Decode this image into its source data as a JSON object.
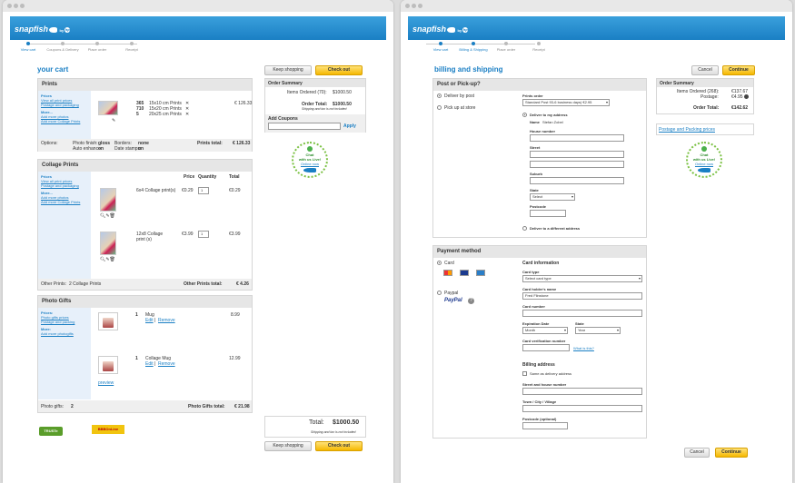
{
  "left": {
    "brand": {
      "logo": "snapfish",
      "by": "by",
      "hp": "hp"
    },
    "steps": [
      "View cart",
      "Coupons & Delivery",
      "Place order",
      "Receipt"
    ],
    "title": "your cart",
    "buttons": {
      "keep": "Keep shopping",
      "checkout": "Check out"
    },
    "summary": {
      "title": "Order Summary",
      "items_label": "Items Ordered (70):",
      "items_value": "$1000.50",
      "total_label": "Order Total:",
      "total_value": "$1000.50",
      "note": "Shipping and tax is not included",
      "coupons": "Add Coupons",
      "apply": "Apply"
    },
    "chat": {
      "line1": "Chat",
      "line2": "with us Live!",
      "link": "Online now"
    },
    "prints": {
      "header": "Prints",
      "side": {
        "prices": "Prices",
        "view": "View all print prices",
        "postage": "Postage and packaging",
        "more": "More...",
        "add_photos": "Add more photos",
        "add_collage": "Add more Collage Prints"
      },
      "rows": [
        {
          "qty": "365",
          "desc": "15x10 cm Prints"
        },
        {
          "qty": "710",
          "desc": "15x20 cm Prints"
        },
        {
          "qty": "5",
          "desc": "20x25 cm Prints"
        }
      ],
      "price": "€ 126.33",
      "options_label": "Options:",
      "finish_label": "Photo finish:",
      "finish": "gloss",
      "borders_label": "Borders:",
      "borders": "none",
      "auto_label": "Auto enhance:",
      "auto": "on",
      "date_label": "Date stamps:",
      "date": "on",
      "total_label": "Prints total:",
      "total": "€ 126.33"
    },
    "collage": {
      "header": "Collage Prints",
      "side": {
        "prices": "Prices",
        "view": "View all print prices",
        "postage": "Postage and packaging",
        "more": "More...",
        "add_photos": "Add more photos",
        "add_collage": "Add more Collage Prints"
      },
      "cols": {
        "price": "Price",
        "qty": "Quantity",
        "total": "Total"
      },
      "items": [
        {
          "name": "6x4 Collage print(s)",
          "price": "€0.29",
          "qty": "1",
          "total": "€0.29"
        },
        {
          "name": "12x8 Collage print (s)",
          "price": "€3.99",
          "qty": "1",
          "total": "€3.99"
        }
      ],
      "other_label": "Other Prints:",
      "other_value": "2 Collage Prints",
      "total_label": "Other Prints total:",
      "total": "€ 4.26"
    },
    "gifts": {
      "header": "Photo Gifts",
      "side": {
        "prices": "Prices:",
        "gift": "Photo gifts prices",
        "postage": "Postage and packing",
        "more": "More:",
        "add": "Add more photogifts"
      },
      "items": [
        {
          "qty": "1",
          "name": "Mug",
          "price": "8.99"
        },
        {
          "qty": "1",
          "name": "Collage Mug",
          "price": "12.99"
        }
      ],
      "edit": "Edit",
      "remove": "Remove",
      "preview": "preview",
      "gifts_label": "Photo gifts:",
      "gifts_value": "2",
      "total_label": "Photo Gifts total:",
      "total": "€ 21.98"
    },
    "bottom": {
      "total_label": "Total:",
      "total": "$1000.50",
      "note": "Shipping and tax is not included"
    },
    "badges": {
      "truste": "TRUSTe",
      "bbb": "BBBOnLine"
    }
  },
  "right": {
    "steps": [
      "View cart",
      "Billing & Shipping",
      "Place order",
      "Receipt"
    ],
    "title": "billing and shipping",
    "buttons": {
      "cancel": "Cancel",
      "continue": "Continue"
    },
    "summary": {
      "title": "Order Summary",
      "items_label": "Items Ordered (268):",
      "items_value": "€137.67",
      "postage_label": "Postage:",
      "postage_value": "€4.95",
      "total_label": "Order Total:",
      "total_value": "€142.62",
      "postage_link": "Postage and Packing prices"
    },
    "post": {
      "header": "Post or Pick-up?",
      "deliver": "Deliver by post",
      "pickup": "Pick up at store",
      "prints_order": "Prints order",
      "prints_value": "Standard Post 93-6 business days) €2.95",
      "deliver_me": "Deliver to my address",
      "name_label": "Name",
      "name": "Stefan Zobel",
      "house": "House number",
      "street": "Street",
      "suburb": "Suburb",
      "state": "State",
      "state_value": "Select",
      "postcode": "Postcode",
      "deliver_other": "Deliver to a different address"
    },
    "payment": {
      "header": "Payment method",
      "card": "Card",
      "paypal": "Paypal",
      "paypal_logo": "PayPal",
      "help": "?",
      "card_info": "Card information",
      "card_type": "Card type",
      "card_type_value": "Select card type",
      "holder": "Card holder's name",
      "holder_value": "Fred Flinstone",
      "number": "Card number",
      "exp": "Expiration Date",
      "exp_value": "Month",
      "exp_state": "State",
      "year": "Year",
      "cvn": "Card verification number",
      "what": "What is this?",
      "billing": "Billing address",
      "same": "Same as delivery address",
      "street": "Street and house number",
      "town": "Town / City / Village",
      "postcode": "Postcode (optional)"
    }
  }
}
